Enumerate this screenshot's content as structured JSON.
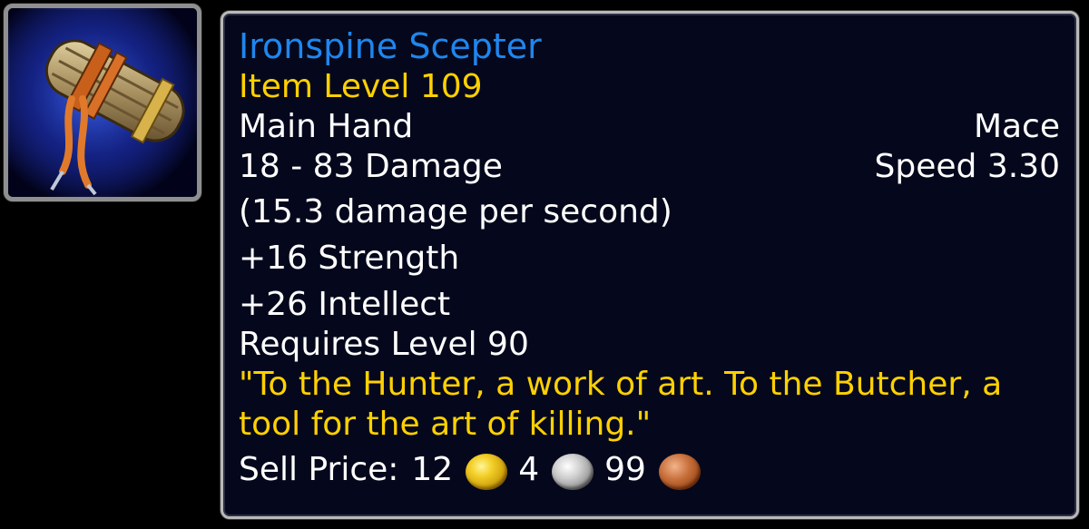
{
  "item": {
    "icon": "mace-scepter-icon",
    "name": "Ironspine Scepter",
    "name_color": "#1f86ee",
    "item_level": "Item Level 109",
    "slot": "Main Hand",
    "type": "Mace",
    "damage": "18 - 83 Damage",
    "speed": "Speed 3.30",
    "dps": "(15.3 damage per second)",
    "stats": [
      "+16 Strength",
      "+26 Intellect"
    ],
    "requirement": "Requires Level 90",
    "flavor_text": "\"To the Hunter, a work of art. To the Butcher, a tool for the art of killing.\"",
    "sell_price": {
      "label": "Sell Price:",
      "gold": "12",
      "silver": "4",
      "copper": "99"
    }
  },
  "colors": {
    "tooltip_background": "#05081c",
    "tooltip_border": "#b9b9b9",
    "flavor_gold": "#ffd100",
    "text_white": "#ffffff"
  }
}
